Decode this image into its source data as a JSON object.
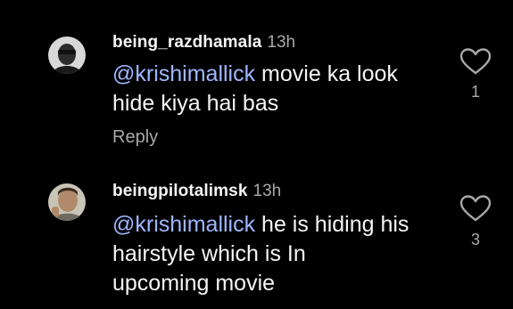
{
  "comments": [
    {
      "username": "being_razdhamala",
      "time": "13h",
      "mention": "@krishimallick",
      "text_line1": " movie ka look",
      "text_line2": "hide kiya hai bas",
      "reply_label": "Reply",
      "like_count": "1",
      "like_icon": "heart-outline-icon"
    },
    {
      "username": "beingpilotalimsk",
      "time": "13h",
      "mention": "@krishimallick",
      "text_line1": " he is hiding his",
      "text_line2": "hairstyle which is In",
      "text_line3": "upcoming movie",
      "like_count": "3",
      "like_icon": "heart-outline-icon"
    }
  ],
  "colors": {
    "background": "#000000",
    "text": "#f5f5f5",
    "secondary": "#a8a8a8",
    "mention": "#9fb6ff"
  }
}
